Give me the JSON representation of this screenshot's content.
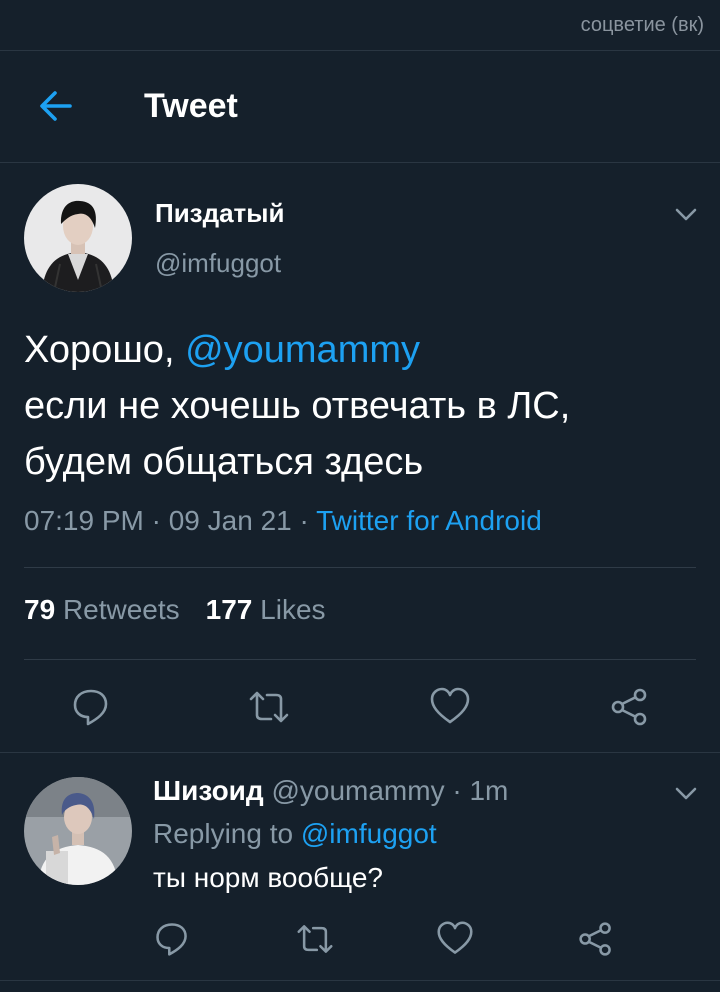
{
  "watermark": "соцветие (вк)",
  "header": {
    "title": "Tweet"
  },
  "tweet": {
    "author_name": "Пиздатый",
    "author_handle": "@imfuggot",
    "text_prefix": "Хорошо, ",
    "text_mention": "@youmammy",
    "text_line2": "если не хочешь отвечать в ЛС,",
    "text_line3": "будем общаться здесь",
    "timestamp": "07:19 PM · 09 Jan 21 · ",
    "source": "Twitter for Android",
    "retweets_count": "79",
    "retweets_label": "Retweets",
    "likes_count": "177",
    "likes_label": "Likes"
  },
  "reply": {
    "name": "Шизоид",
    "meta": " @youmammy · 1m",
    "replying_prefix": "Replying to ",
    "replying_mention": "@imfuggot",
    "text": "ты норм вообще?"
  },
  "icons": {
    "back": "arrow-left-icon",
    "menu": "chevron-down-icon",
    "reply": "reply-bubble-icon",
    "retweet": "retweet-icon",
    "like": "heart-icon",
    "share": "share-icon"
  },
  "colors": {
    "background": "#15202b",
    "accent": "#1da1f2",
    "secondary_text": "#8899a6"
  }
}
